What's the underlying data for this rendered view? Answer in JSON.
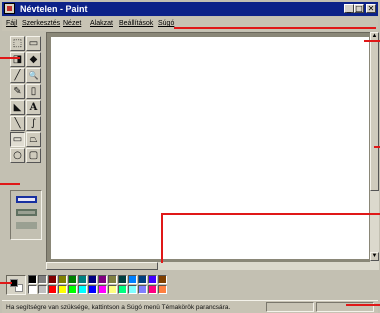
{
  "window": {
    "title": "Névtelen - Paint",
    "controls": {
      "minimize": "_",
      "maximize": "□",
      "close": "✕"
    }
  },
  "menu": {
    "items": [
      "Fájl",
      "Szerkesztés",
      "Nézet",
      "Alakzat",
      "Beállítások",
      "Súgó"
    ]
  },
  "tools": [
    {
      "name": "free-select",
      "glyph": "⬚"
    },
    {
      "name": "select",
      "glyph": "▭"
    },
    {
      "name": "eraser",
      "glyph": "◨"
    },
    {
      "name": "fill",
      "glyph": "◆"
    },
    {
      "name": "color-picker",
      "glyph": "╱"
    },
    {
      "name": "magnifier",
      "glyph": "🔍"
    },
    {
      "name": "pencil",
      "glyph": "✎"
    },
    {
      "name": "brush",
      "glyph": "▯"
    },
    {
      "name": "airbrush",
      "glyph": "◣"
    },
    {
      "name": "text",
      "glyph": "A"
    },
    {
      "name": "line",
      "glyph": "╲"
    },
    {
      "name": "curve",
      "glyph": "∫"
    },
    {
      "name": "rectangle",
      "glyph": "▭"
    },
    {
      "name": "polygon",
      "glyph": "⏢"
    },
    {
      "name": "ellipse",
      "glyph": "○"
    },
    {
      "name": "rounded-rectangle",
      "glyph": "▢"
    }
  ],
  "palette": {
    "foreground": "#000000",
    "background": "#ffffff",
    "colors": [
      "#000000",
      "#808080",
      "#800000",
      "#808000",
      "#008000",
      "#008080",
      "#000080",
      "#800080",
      "#808040",
      "#004040",
      "#0080ff",
      "#004080",
      "#4000ff",
      "#804000",
      "#ffffff",
      "#c0c0c0",
      "#ff0000",
      "#ffff00",
      "#00ff00",
      "#00ffff",
      "#0000ff",
      "#ff00ff",
      "#ffff80",
      "#00ff80",
      "#80ffff",
      "#8080ff",
      "#ff0080",
      "#ff8040"
    ]
  },
  "status": {
    "text": "Ha segítségre van szüksége, kattintson a Súgó menü Témakörök parancsára."
  },
  "accent": {
    "titlebar": "#0c2288",
    "callout": "#e01818"
  }
}
